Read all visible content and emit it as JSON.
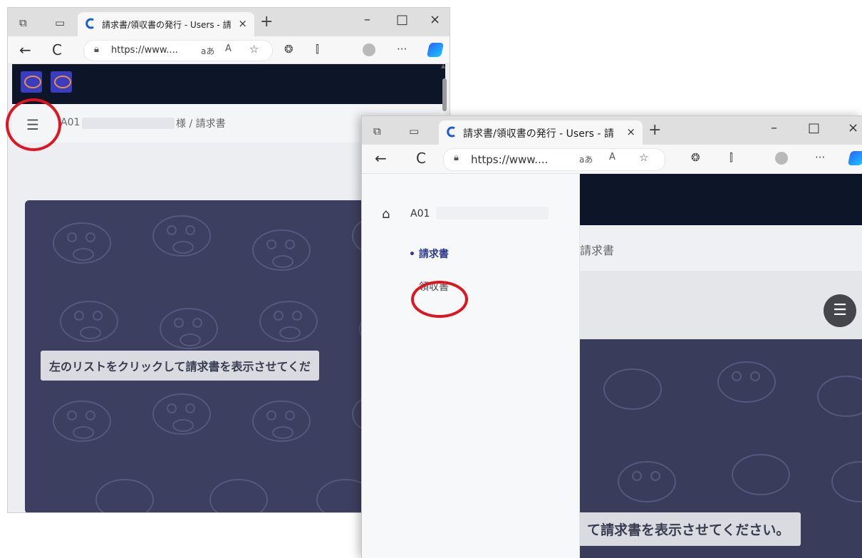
{
  "browser": {
    "tab_title": "請求書/領収書の発行 - Users - 請",
    "tab_close": "×",
    "new_tab": "+",
    "url": "https://www....",
    "read_aloud_a": "aあ",
    "read_aloud_b": "A",
    "favorite": "☆",
    "menu": "···",
    "minimize": "–",
    "maximize": "□",
    "close": "×",
    "back": "←",
    "refresh": "C",
    "extensions": "❂",
    "split": "⫿"
  },
  "breadcrumb": {
    "user_prefix": "A01",
    "user_suffix_path": "様 / 請求書",
    "partial_path": "請求書"
  },
  "message": {
    "window1": "左のリストをクリックして請求書を表示させてくだ",
    "window2": "て請求書を表示させてください。"
  },
  "sidebar": {
    "user": "A01",
    "items": [
      {
        "label": "• 請求書",
        "active": true
      },
      {
        "label": "領収書",
        "active": false
      }
    ]
  },
  "colors": {
    "annotation": "#e0141f",
    "navbar": "#0d1628",
    "card": "#3d3f60"
  },
  "icons": [
    "tab-actions-icon",
    "tab-strip-icon",
    "home-icon",
    "hamburger-icon",
    "lock-icon",
    "avatar-icon",
    "copilot-icon"
  ]
}
